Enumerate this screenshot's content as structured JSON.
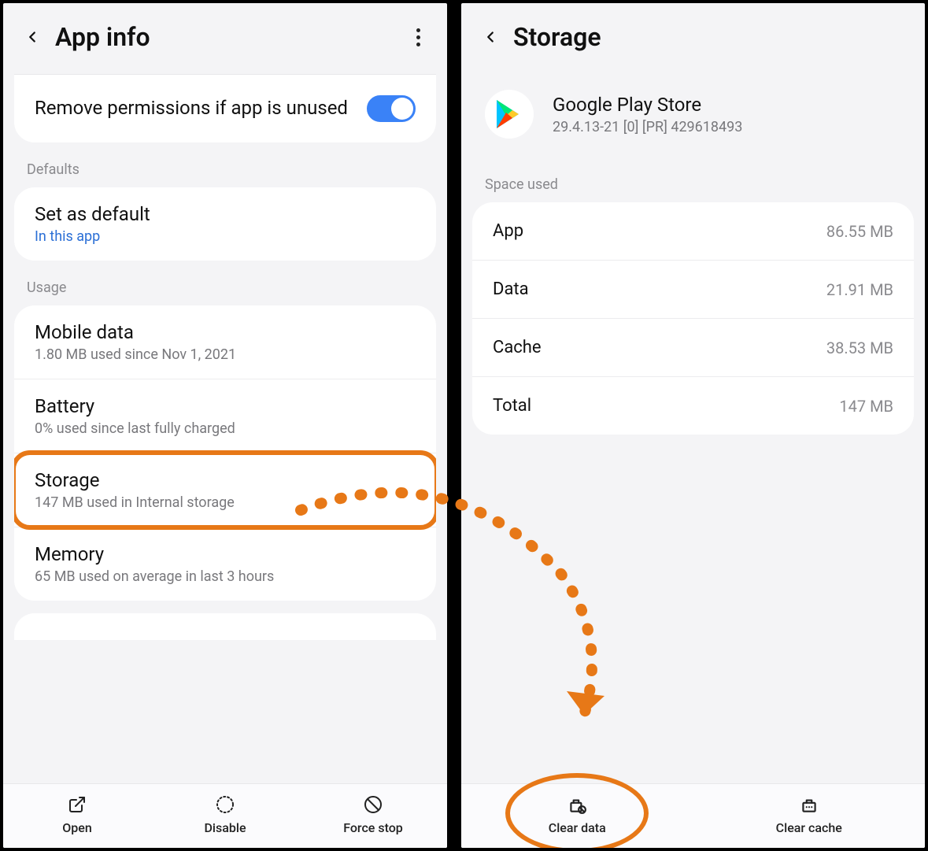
{
  "left": {
    "title": "App info",
    "permissions_toggle_label": "Remove permissions if app is unused",
    "sections": {
      "defaults_label": "Defaults",
      "set_default_title": "Set as default",
      "set_default_sub": "In this app",
      "usage_label": "Usage",
      "mobile_data_title": "Mobile data",
      "mobile_data_sub": "1.80 MB used since Nov 1, 2021",
      "battery_title": "Battery",
      "battery_sub": "0% used since last fully charged",
      "storage_title": "Storage",
      "storage_sub": "147 MB used in Internal storage",
      "memory_title": "Memory",
      "memory_sub": "65 MB used on average in last 3 hours"
    },
    "bottom": {
      "open": "Open",
      "disable": "Disable",
      "force_stop": "Force stop"
    }
  },
  "right": {
    "title": "Storage",
    "app_name": "Google Play Store",
    "app_version": "29.4.13-21 [0] [PR] 429618493",
    "space_used_label": "Space used",
    "rows": {
      "app_label": "App",
      "app_value": "86.55 MB",
      "data_label": "Data",
      "data_value": "21.91 MB",
      "cache_label": "Cache",
      "cache_value": "38.53 MB",
      "total_label": "Total",
      "total_value": "147 MB"
    },
    "bottom": {
      "clear_data": "Clear data",
      "clear_cache": "Clear cache"
    }
  }
}
